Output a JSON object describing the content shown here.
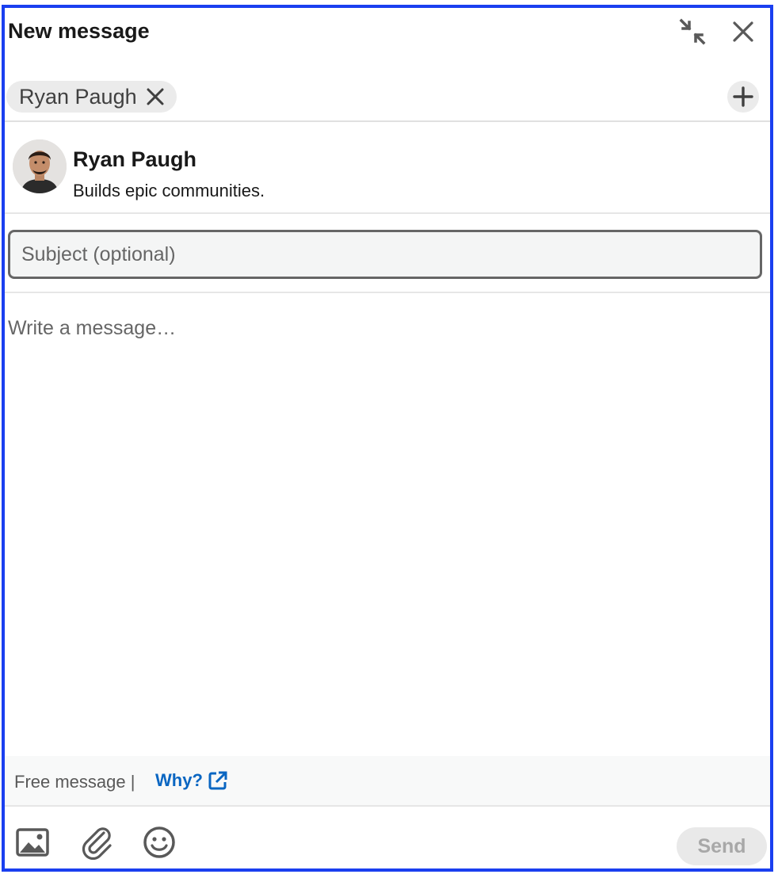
{
  "header": {
    "title": "New message",
    "minimize_icon": "minimize-arrows-icon",
    "close_icon": "close-icon"
  },
  "recipients": {
    "chips": [
      {
        "label": "Ryan Paugh"
      }
    ],
    "add_icon": "plus-icon"
  },
  "profile": {
    "name": "Ryan Paugh",
    "headline": "Builds epic communities."
  },
  "subject": {
    "placeholder": "Subject (optional)",
    "value": ""
  },
  "message": {
    "placeholder": "Write a message…",
    "value": ""
  },
  "footer_note": {
    "text": "Free message |",
    "link_label": "Why?",
    "link_icon": "external-link-icon"
  },
  "toolbar": {
    "tools": [
      "image-icon",
      "paperclip-icon",
      "emoji-icon"
    ],
    "send_label": "Send"
  },
  "colors": {
    "frame": "#1a3ff0",
    "link": "#0a66c2",
    "chip_bg": "#ebebeb",
    "send_disabled_bg": "#e9e9e9",
    "send_disabled_text": "#a8a8a8"
  }
}
